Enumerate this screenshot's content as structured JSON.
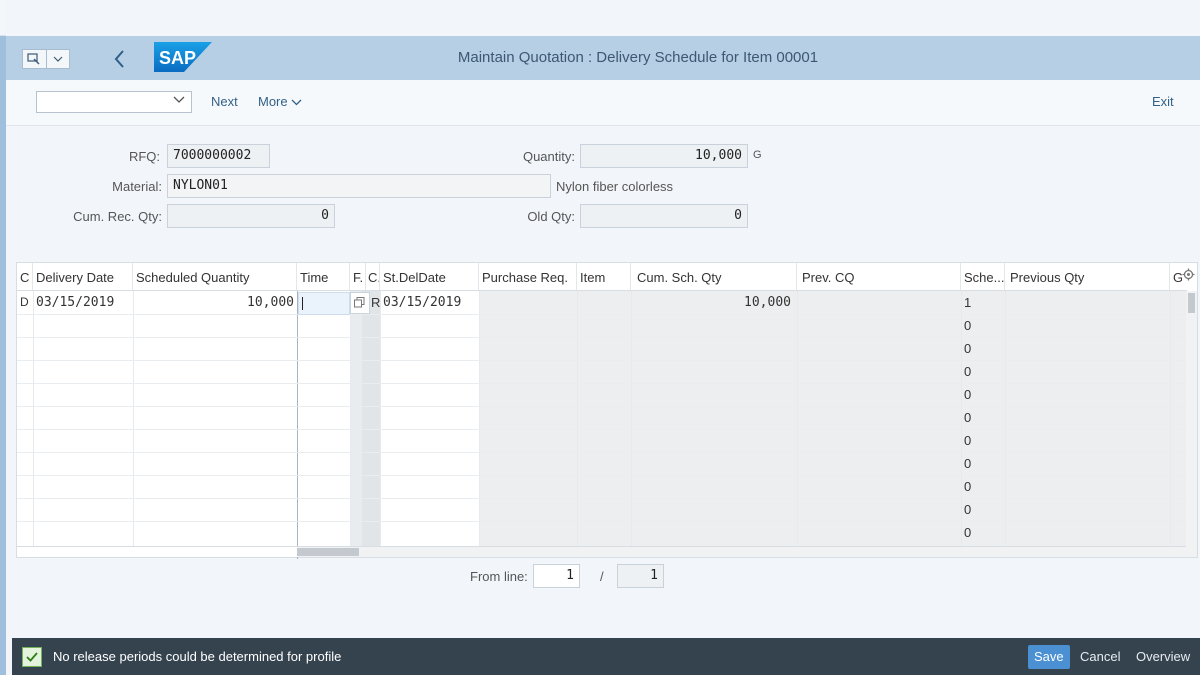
{
  "window": {
    "icons": [
      "menu-icon",
      "back-arrow-icon",
      "lock-icon",
      "minimize-icon",
      "restore-icon",
      "close-icon"
    ]
  },
  "shell": {
    "title": "Maintain Quotation : Delivery Schedule for Item 00001",
    "logo_text": "SAP"
  },
  "toolbar": {
    "select_value": "",
    "next_label": "Next",
    "more_label": "More",
    "exit_label": "Exit"
  },
  "form": {
    "rfq_label": "RFQ:",
    "rfq_value": "7000000002",
    "quantity_label": "Quantity:",
    "quantity_value": "10,000",
    "quantity_unit": "G",
    "material_label": "Material:",
    "material_value": "NYLON01",
    "material_desc": "Nylon fiber colorless",
    "cum_rec_label": "Cum. Rec. Qty:",
    "cum_rec_value": "0",
    "old_qty_label": "Old Qty:",
    "old_qty_value": "0"
  },
  "table": {
    "headers": {
      "c": "C",
      "delivery_date": "Delivery Date",
      "scheduled_qty": "Scheduled Quantity",
      "time": "Time",
      "f": "F.",
      "c2": "C.",
      "st_del_date": "St.DelDate",
      "purchase_req": "Purchase Req.",
      "item": "Item",
      "cum_sch_qty": "Cum. Sch. Qty",
      "prev_cq": "Prev. CQ",
      "sche": "Sche...",
      "previous_qty": "Previous Qty",
      "g": "G"
    },
    "row1": {
      "c": "D",
      "delivery_date": "03/15/2019",
      "scheduled_qty": "10,000",
      "c2": "R",
      "st_del_date": "03/15/2019",
      "cum_sch_qty": "10,000"
    },
    "sche_values": [
      "1",
      "0",
      "0",
      "0",
      "0",
      "0",
      "0",
      "0",
      "0",
      "0",
      "0"
    ]
  },
  "pager": {
    "from_line_label": "From line:",
    "from_line_value": "1",
    "separator": "/",
    "total_value": "1"
  },
  "status": {
    "message": "No release periods could be determined for profile",
    "save_label": "Save",
    "cancel_label": "Cancel",
    "overview_label": "Overview"
  }
}
